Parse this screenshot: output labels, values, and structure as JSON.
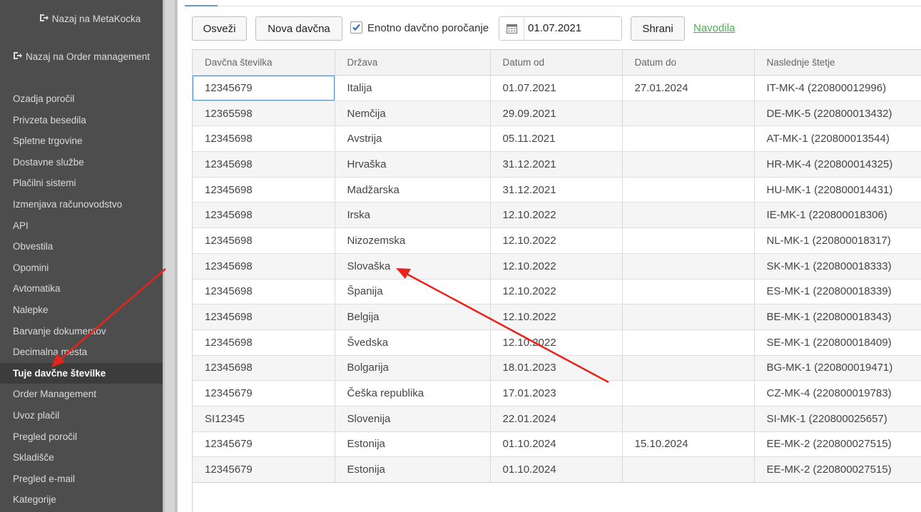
{
  "sidebar": {
    "back_metakocka": "Nazaj na MetaKocka",
    "back_order": "Nazaj na Order management",
    "items": [
      {
        "label": "Ozadja poročil"
      },
      {
        "label": "Privzeta besedila"
      },
      {
        "label": "Spletne trgovine"
      },
      {
        "label": "Dostavne službe"
      },
      {
        "label": "Plačilni sistemi"
      },
      {
        "label": "Izmenjava računovodstvo"
      },
      {
        "label": "API"
      },
      {
        "label": "Obvestila"
      },
      {
        "label": "Opomini"
      },
      {
        "label": "Avtomatika"
      },
      {
        "label": "Nalepke"
      },
      {
        "label": "Barvanje dokumentov"
      },
      {
        "label": "Decimalna mesta"
      },
      {
        "label": "Tuje davčne številke",
        "active": true
      },
      {
        "label": "Order Management"
      },
      {
        "label": "Uvoz plačil"
      },
      {
        "label": "Pregled poročil"
      },
      {
        "label": "Skladišče"
      },
      {
        "label": "Pregled e-mail"
      },
      {
        "label": "Kategorije"
      }
    ]
  },
  "toolbar": {
    "refresh_label": "Osveži",
    "new_label": "Nova davčna",
    "unified_reporting_label": "Enotno davčno poročanje",
    "unified_reporting_checked": true,
    "date_value": "01.07.2021",
    "save_label": "Shrani",
    "help_link": "Navodila"
  },
  "grid": {
    "columns": [
      "Davčna številka",
      "Država",
      "Datum od",
      "Datum do",
      "Naslednje štetje"
    ],
    "rows": [
      [
        "12345679",
        "Italija",
        "01.07.2021",
        "27.01.2024",
        "IT-MK-4 (220800012996)"
      ],
      [
        "12365598",
        "Nemčija",
        "29.09.2021",
        "",
        "DE-MK-5 (220800013432)"
      ],
      [
        "12345698",
        "Avstrija",
        "05.11.2021",
        "",
        "AT-MK-1 (220800013544)"
      ],
      [
        "12345698",
        "Hrvaška",
        "31.12.2021",
        "",
        "HR-MK-4 (220800014325)"
      ],
      [
        "12345698",
        "Madžarska",
        "31.12.2021",
        "",
        "HU-MK-1 (220800014431)"
      ],
      [
        "12345698",
        "Irska",
        "12.10.2022",
        "",
        "IE-MK-1 (220800018306)"
      ],
      [
        "12345698",
        "Nizozemska",
        "12.10.2022",
        "",
        "NL-MK-1 (220800018317)"
      ],
      [
        "12345698",
        "Slovaška",
        "12.10.2022",
        "",
        "SK-MK-1 (220800018333)"
      ],
      [
        "12345698",
        "Španija",
        "12.10.2022",
        "",
        "ES-MK-1 (220800018339)"
      ],
      [
        "12345698",
        "Belgija",
        "12.10.2022",
        "",
        "BE-MK-1 (220800018343)"
      ],
      [
        "12345698",
        "Švedska",
        "12.10.2022",
        "",
        "SE-MK-1 (220800018409)"
      ],
      [
        "12345698",
        "Bolgarija",
        "18.01.2023",
        "",
        "BG-MK-1 (220800019471)"
      ],
      [
        "12345679",
        "Češka republika",
        "17.01.2023",
        "",
        "CZ-MK-4 (220800019783)"
      ],
      [
        "SI12345",
        "Slovenija",
        "22.01.2024",
        "",
        "SI-MK-1 (220800025657)"
      ],
      [
        "12345679",
        "Estonija",
        "01.10.2024",
        "15.10.2024",
        "EE-MK-2 (220800027515)"
      ],
      [
        "12345679",
        "Estonija",
        "01.10.2024",
        "",
        "EE-MK-2 (220800027515)"
      ]
    ]
  },
  "colors": {
    "sidebar_bg": "#4d4d4d",
    "sidebar_active_bg": "#3c3c3c",
    "link_green": "#4caf50",
    "annotation_red": "#e8231c",
    "selection_blue": "#5b8fc9"
  }
}
